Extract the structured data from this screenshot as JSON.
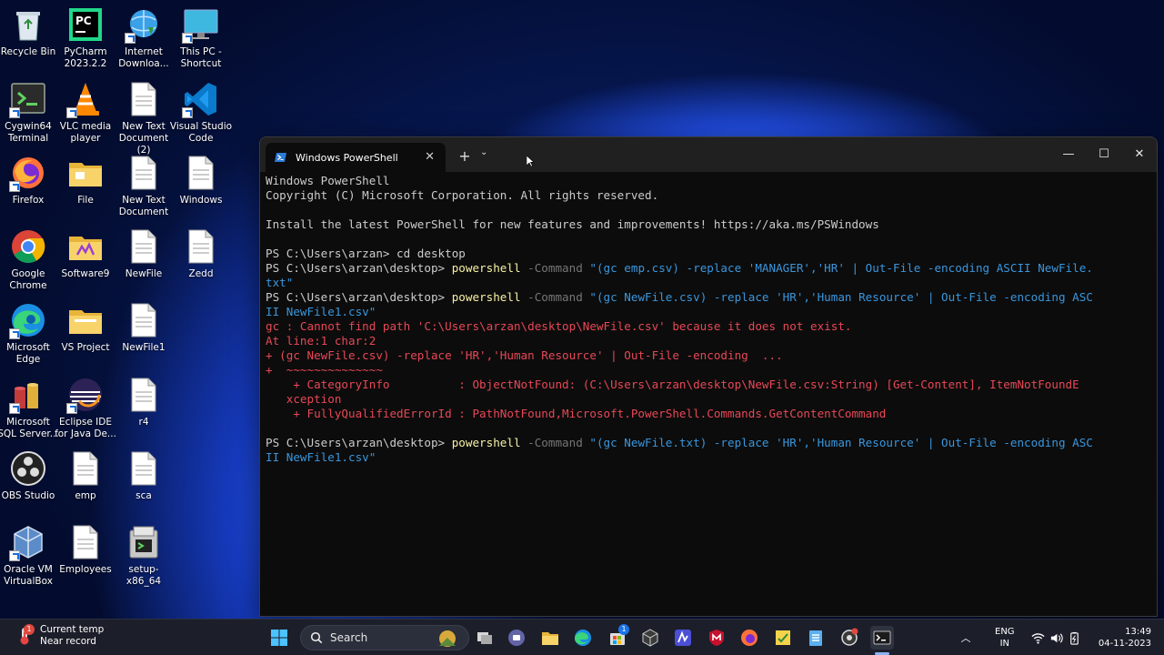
{
  "desktop": {
    "icons": [
      {
        "label": "Recycle Bin"
      },
      {
        "label": "PyCharm 2023.2.2"
      },
      {
        "label": "Internet Downloa..."
      },
      {
        "label": "This PC - Shortcut"
      },
      {
        "label": "Cygwin64 Terminal"
      },
      {
        "label": "VLC media player"
      },
      {
        "label": "New Text Document (2)"
      },
      {
        "label": "Visual Studio Code"
      },
      {
        "label": "Firefox"
      },
      {
        "label": "File"
      },
      {
        "label": "New Text Document"
      },
      {
        "label": "Windows"
      },
      {
        "label": "Google Chrome"
      },
      {
        "label": "Software9"
      },
      {
        "label": "NewFile"
      },
      {
        "label": "Zedd"
      },
      {
        "label": "Microsoft Edge"
      },
      {
        "label": "VS Project"
      },
      {
        "label": "NewFile1"
      },
      {
        "label": "Microsoft SQL Server..."
      },
      {
        "label": "Eclipse IDE for Java De..."
      },
      {
        "label": "r4"
      },
      {
        "label": "OBS Studio"
      },
      {
        "label": "emp"
      },
      {
        "label": "sca"
      },
      {
        "label": "Oracle VM VirtualBox"
      },
      {
        "label": "Employees"
      },
      {
        "label": "setup-x86_64"
      }
    ]
  },
  "terminal": {
    "tab_title": "Windows PowerShell",
    "new_tab_glyph": "+",
    "dropdown_glyph": "⌄",
    "minimize_glyph": "—",
    "maximize_glyph": "☐",
    "close_glyph": "✕",
    "lines": [
      [
        {
          "t": "Windows PowerShell",
          "c": ""
        }
      ],
      [
        {
          "t": "Copyright (C) Microsoft Corporation. All rights reserved.",
          "c": ""
        }
      ],
      [
        {
          "t": "",
          "c": ""
        }
      ],
      [
        {
          "t": "Install the latest PowerShell for new features and improvements! https://aka.ms/PSWindows",
          "c": ""
        }
      ],
      [
        {
          "t": "",
          "c": ""
        }
      ],
      [
        {
          "t": "PS C:\\Users\\arzan> cd desktop",
          "c": ""
        }
      ],
      [
        {
          "t": "PS C:\\Users\\arzan\\desktop> ",
          "c": ""
        },
        {
          "t": "powershell",
          "c": "c-yel"
        },
        {
          "t": " -Command ",
          "c": "c-gry"
        },
        {
          "t": "\"(gc emp.csv) -replace 'MANAGER','HR' | Out-File -encoding ASCII NewFile.",
          "c": "c-cyn"
        }
      ],
      [
        {
          "t": "txt\"",
          "c": "c-cyn"
        }
      ],
      [
        {
          "t": "PS C:\\Users\\arzan\\desktop> ",
          "c": ""
        },
        {
          "t": "powershell",
          "c": "c-yel"
        },
        {
          "t": " -Command ",
          "c": "c-gry"
        },
        {
          "t": "\"(gc NewFile.csv) -replace 'HR','Human Resource' | Out-File -encoding ASC",
          "c": "c-cyn"
        }
      ],
      [
        {
          "t": "II NewFile1.csv\"",
          "c": "c-cyn"
        }
      ],
      [
        {
          "t": "gc : Cannot find path 'C:\\Users\\arzan\\desktop\\NewFile.csv' because it does not exist.",
          "c": "c-red"
        }
      ],
      [
        {
          "t": "At line:1 char:2",
          "c": "c-red"
        }
      ],
      [
        {
          "t": "+ (gc NewFile.csv) -replace 'HR','Human Resource' | Out-File -encoding  ...",
          "c": "c-red"
        }
      ],
      [
        {
          "t": "+  ~~~~~~~~~~~~~~",
          "c": "c-red"
        }
      ],
      [
        {
          "t": "    + CategoryInfo          : ObjectNotFound: (C:\\Users\\arzan\\desktop\\NewFile.csv:String) [Get-Content], ItemNotFoundE",
          "c": "c-red"
        }
      ],
      [
        {
          "t": "   xception",
          "c": "c-red"
        }
      ],
      [
        {
          "t": "    + FullyQualifiedErrorId : PathNotFound,Microsoft.PowerShell.Commands.GetContentCommand",
          "c": "c-red"
        }
      ],
      [
        {
          "t": "",
          "c": ""
        }
      ],
      [
        {
          "t": "PS C:\\Users\\arzan\\desktop> ",
          "c": ""
        },
        {
          "t": "powershell",
          "c": "c-yel"
        },
        {
          "t": " -Command ",
          "c": "c-gry"
        },
        {
          "t": "\"(gc NewFile.txt) -replace 'HR','Human Resource' | Out-File -encoding ASC",
          "c": "c-cyn"
        }
      ],
      [
        {
          "t": "II NewFile1.csv\"",
          "c": "c-cyn"
        }
      ]
    ]
  },
  "taskbar": {
    "weather_title": "Current temp",
    "weather_sub": "Near record",
    "weather_badge": "1",
    "search_placeholder": "Search",
    "tray_lang_top": "ENG",
    "tray_lang_bottom": "IN",
    "clock_time": "13:49",
    "clock_date": "04-11-2023",
    "store_badge": "1"
  },
  "colors": {
    "terminal_bg": "#0c0c0c",
    "titlebar_bg": "#202020",
    "command": "#f9f1a5",
    "parameter": "#767676",
    "string": "#3a96dd",
    "error": "#e74856",
    "taskbar_bg": "#1c1f2a"
  }
}
